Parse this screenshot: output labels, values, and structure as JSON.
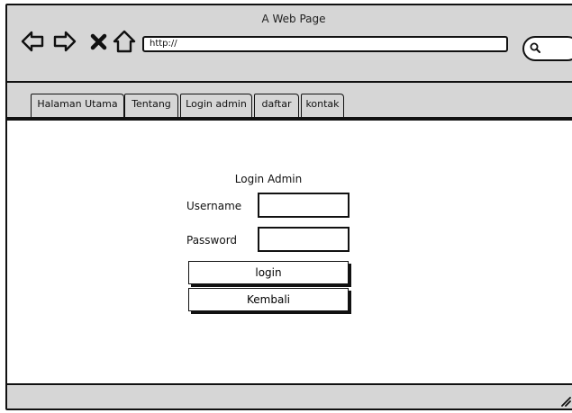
{
  "window": {
    "title": "A Web Page"
  },
  "toolbar": {
    "back_icon": "back-arrow-icon",
    "forward_icon": "forward-arrow-icon",
    "stop_icon": "close-icon",
    "home_icon": "home-icon",
    "url": "http://",
    "search_icon": "search-icon"
  },
  "tabs": [
    {
      "label": "Halaman Utama"
    },
    {
      "label": "Tentang"
    },
    {
      "label": "Login admin"
    },
    {
      "label": "daftar"
    },
    {
      "label": "kontak"
    }
  ],
  "login_form": {
    "title": "Login Admin",
    "username_label": "Username",
    "username_value": "",
    "password_label": "Password",
    "password_value": "",
    "login_button": "login",
    "back_button": "Kembali"
  },
  "colors": {
    "chrome": "#d6d6d6",
    "outline": "#111111",
    "page": "#ffffff"
  }
}
